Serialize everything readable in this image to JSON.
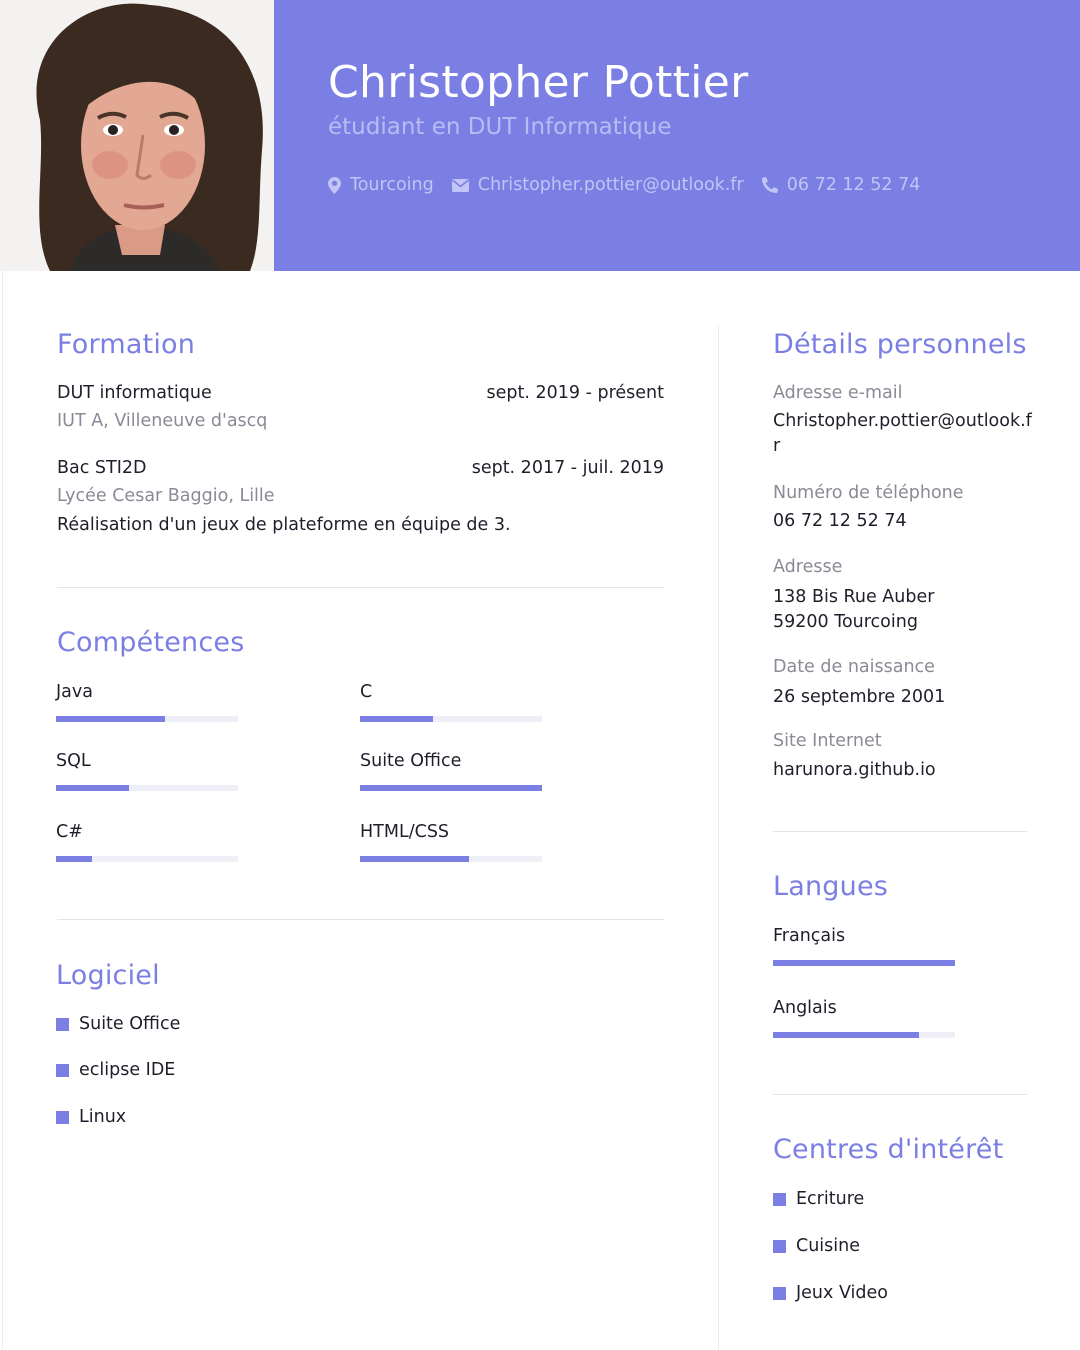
{
  "header": {
    "name": "Christopher Pottier",
    "subtitle": "étudiant en DUT Informatique",
    "location": "Tourcoing",
    "email": "Christopher.pottier@outlook.fr",
    "phone": "06 72 12 52 74"
  },
  "formation": {
    "title": "Formation",
    "items": [
      {
        "degree": "DUT informatique",
        "date": "sept. 2019 - présent",
        "school": "IUT A, Villeneuve d'ascq",
        "description": ""
      },
      {
        "degree": "Bac STI2D",
        "date": "sept. 2017 - juil. 2019",
        "school": "Lycée Cesar Baggio, Lille",
        "description": "Réalisation d'un jeux de plateforme en équipe de 3."
      }
    ]
  },
  "competences": {
    "title": "Compétences",
    "items": [
      {
        "label": "Java",
        "level": 0.6
      },
      {
        "label": "C",
        "level": 0.4
      },
      {
        "label": "SQL",
        "level": 0.4
      },
      {
        "label": "Suite Office",
        "level": 1.0
      },
      {
        "label": "C#",
        "level": 0.2
      },
      {
        "label": "HTML/CSS",
        "level": 0.6
      }
    ]
  },
  "logiciel": {
    "title": "Logiciel",
    "items": [
      "Suite Office",
      "eclipse IDE",
      "Linux"
    ]
  },
  "details": {
    "title": "Détails personnels",
    "email_label": "Adresse e-mail",
    "email_value": "Christopher.pottier@outlook.fr",
    "phone_label": "Numéro de téléphone",
    "phone_value": "06 72 12 52 74",
    "address_label": "Adresse",
    "address_line1": "138 Bis Rue Auber",
    "address_line2": "59200 Tourcoing",
    "birth_label": "Date de naissance",
    "birth_value": "26 septembre 2001",
    "website_label": "Site Internet",
    "website_value": "harunora.github.io"
  },
  "langues": {
    "title": "Langues",
    "items": [
      {
        "label": "Français",
        "level": 1.0
      },
      {
        "label": "Anglais",
        "level": 0.8
      }
    ]
  },
  "interets": {
    "title": "Centres d'intérêt",
    "items": [
      "Ecriture",
      "Cuisine",
      "Jeux Video"
    ]
  },
  "colors": {
    "accent": "#7b7fe3",
    "track": "#eeeef6",
    "muted_text": "#8a8a96"
  },
  "icons": {
    "location": "map-pin-icon",
    "email": "envelope-icon",
    "phone": "phone-icon"
  }
}
